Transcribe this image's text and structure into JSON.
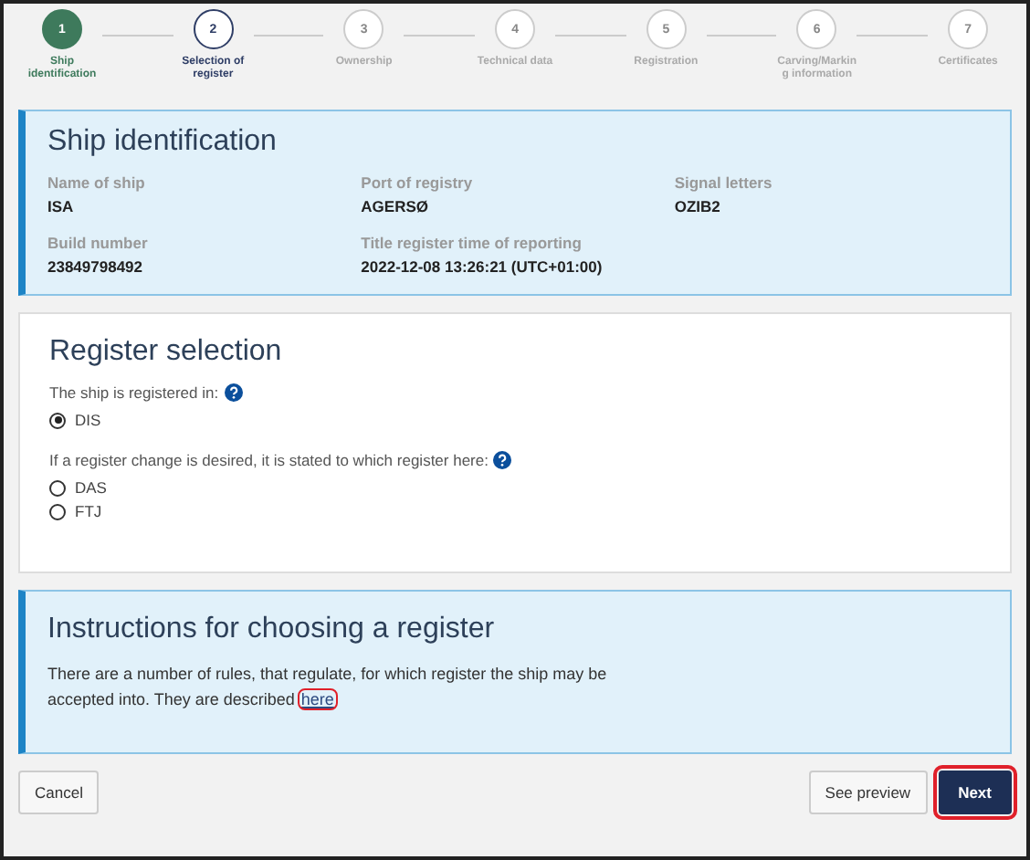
{
  "steps": [
    {
      "number": "1",
      "label": "Ship identification",
      "completed": true,
      "selected": false
    },
    {
      "number": "2",
      "label": "Selection of register",
      "completed": false,
      "selected": true
    },
    {
      "number": "3",
      "label": "Ownership",
      "completed": false,
      "selected": false
    },
    {
      "number": "4",
      "label": "Technical data",
      "completed": false,
      "selected": false
    },
    {
      "number": "5",
      "label": "Registration",
      "completed": false,
      "selected": false
    },
    {
      "number": "6",
      "label": "Carving/Markin g information",
      "completed": false,
      "selected": false
    },
    {
      "number": "7",
      "label": "Certificates",
      "completed": false,
      "selected": false
    }
  ],
  "ship_identification": {
    "title": "Ship identification",
    "fields": [
      {
        "label": "Name of ship",
        "value": "ISA"
      },
      {
        "label": "Port of registry",
        "value": "AGERSØ"
      },
      {
        "label": "Signal letters",
        "value": "OZIB2"
      },
      {
        "label": "Build number",
        "value": "23849798492"
      },
      {
        "label": "Title register time of reporting",
        "value": "2022-12-08 13:26:21 (UTC+01:00)"
      }
    ]
  },
  "register_selection": {
    "title": "Register selection",
    "groups": [
      {
        "question": "The ship is registered in:",
        "options": [
          {
            "label": "DIS",
            "selected": true
          }
        ]
      },
      {
        "question": "If a register change is desired, it is stated to which register here:",
        "options": [
          {
            "label": "DAS",
            "selected": false
          },
          {
            "label": "FTJ",
            "selected": false
          }
        ]
      }
    ]
  },
  "instructions": {
    "title": "Instructions for choosing a register",
    "text": "There are a number of rules, that regulate, for which register the ship may be accepted into. They are described ",
    "link": {
      "label": "here",
      "highlighted": true
    }
  },
  "footer": {
    "cancel": {
      "label": "Cancel",
      "highlighted": false
    },
    "preview": {
      "label": "See preview",
      "highlighted": false
    },
    "next": {
      "label": "Next",
      "highlighted": true
    }
  }
}
